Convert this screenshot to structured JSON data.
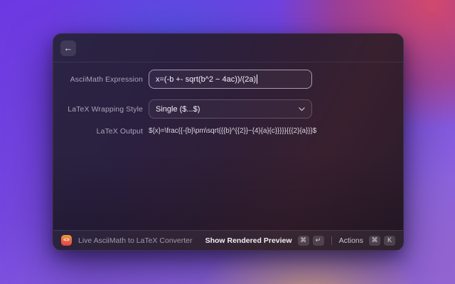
{
  "window": {
    "back_icon": "←"
  },
  "form": {
    "asciimath": {
      "label": "AsciiMath Expression",
      "value": "x=(-b +- sqrt(b^2 − 4ac))/(2a)"
    },
    "wrapping": {
      "label": "LaTeX Wrapping Style",
      "selected": "Single ($...$)"
    },
    "output": {
      "label": "LaTeX Output",
      "value": "${x}=\\frac{{-{b}\\pm\\sqrt{{{b}^{{2}}−{4}{a}{c}}}}}{{{2}{a}}}$"
    }
  },
  "footer": {
    "app_icon_glyph": "<>",
    "title": "Live AsciiMath to LaTeX Converter",
    "primary_action": "Show Rendered Preview",
    "primary_keys": [
      "⌘",
      "↵"
    ],
    "actions_label": "Actions",
    "actions_keys": [
      "⌘",
      "K"
    ]
  },
  "colors": {
    "bg_top_left": "#6c38e2",
    "bg_top_right": "#cc4a6a",
    "bg_bottom_left": "#8d66e0",
    "bg_bottom_right": "#8b64c8",
    "bg_bottom_glow": "#d8a878",
    "app_icon_top": "#f0a03d",
    "app_icon_bottom": "#de3d4e"
  }
}
